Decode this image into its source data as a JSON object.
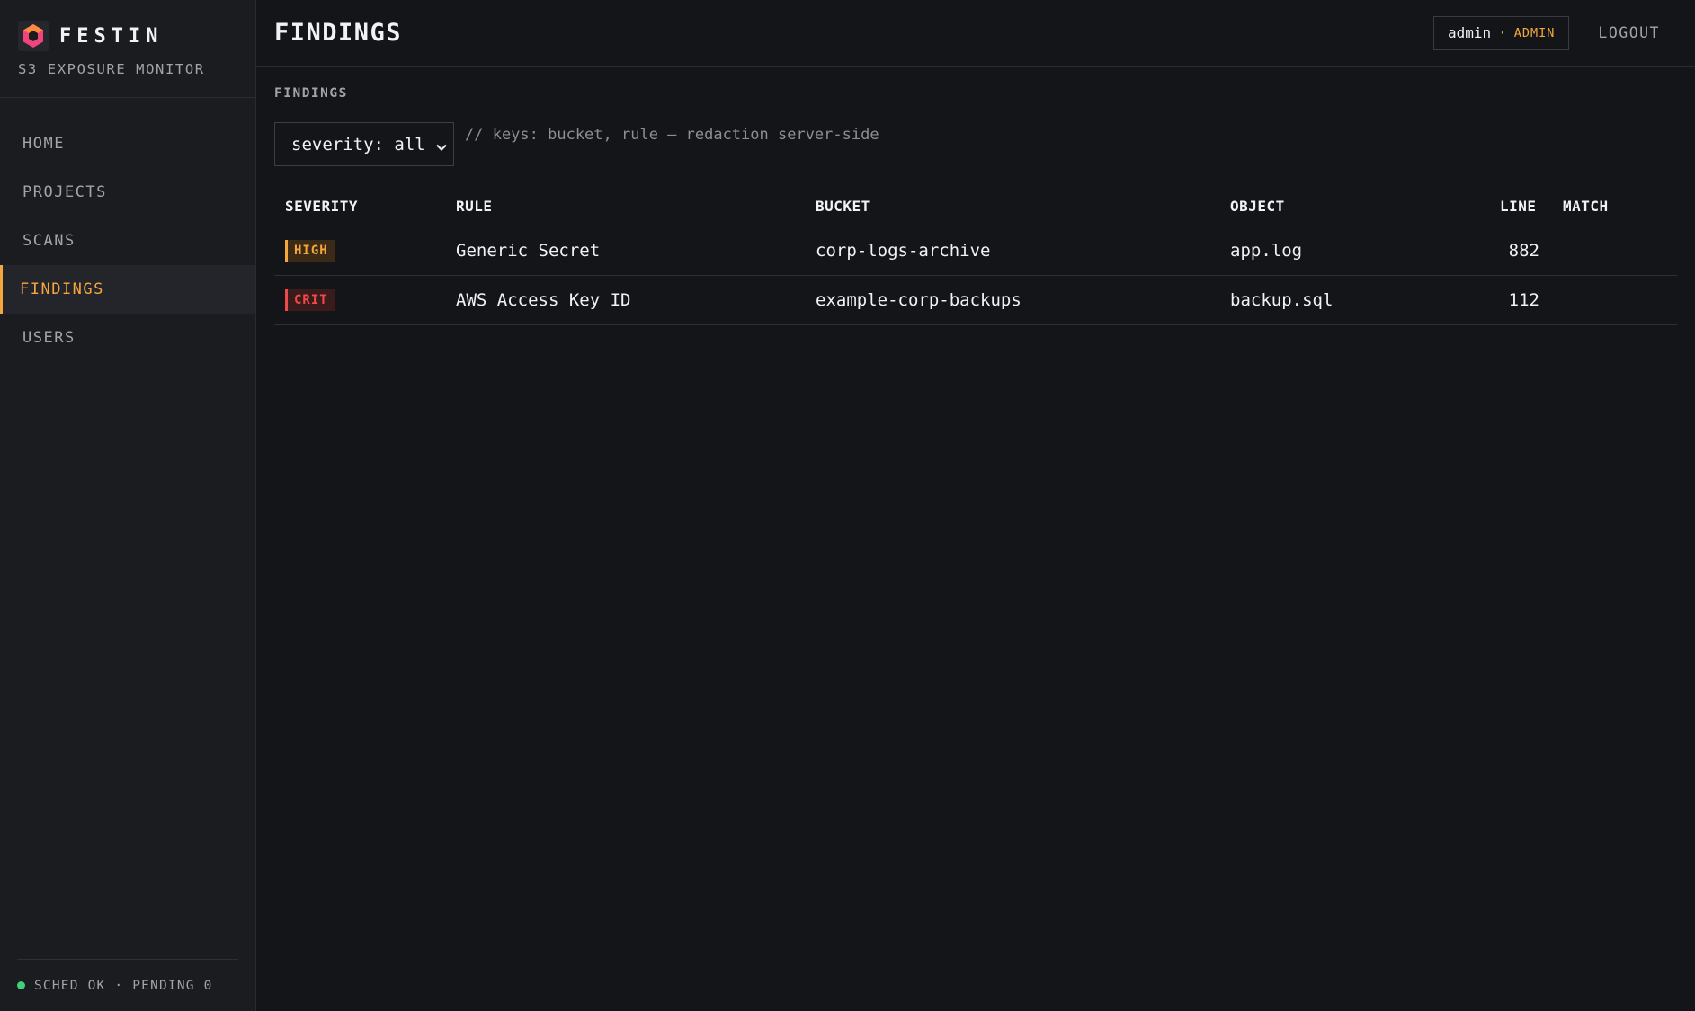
{
  "brand": {
    "name": "FESTIN",
    "subtitle": "S3 EXPOSURE MONITOR"
  },
  "nav": {
    "items": [
      {
        "label": "HOME",
        "active": false
      },
      {
        "label": "PROJECTS",
        "active": false
      },
      {
        "label": "SCANS",
        "active": false
      },
      {
        "label": "FINDINGS",
        "active": true
      },
      {
        "label": "USERS",
        "active": false
      }
    ]
  },
  "footer": {
    "status": "SCHED OK · PENDING 0"
  },
  "header": {
    "title": "FINDINGS",
    "user": {
      "name": "admin",
      "separator": "·",
      "role": "ADMIN"
    },
    "logout_label": "LOGOUT"
  },
  "main": {
    "section_label": "FINDINGS",
    "filter": {
      "selected": "severity: all"
    },
    "hint": "// keys: bucket, rule — redaction server-side",
    "table": {
      "columns": [
        "SEVERITY",
        "RULE",
        "BUCKET",
        "OBJECT",
        "LINE",
        "MATCH"
      ],
      "rows": [
        {
          "severity": "HIGH",
          "rule": "Generic Secret",
          "bucket": "corp-logs-archive",
          "object": "app.log",
          "line": "882",
          "match": ""
        },
        {
          "severity": "CRIT",
          "rule": "AWS Access Key ID",
          "bucket": "example-corp-backups",
          "object": "backup.sql",
          "line": "112",
          "match": ""
        }
      ]
    }
  },
  "colors": {
    "accent": "#f5a63d",
    "critical": "#ef4a4a",
    "ok": "#3fd07a",
    "background": "#141518",
    "sidebar": "#1b1c20"
  },
  "icons": {
    "logo": "festin-hex-logo-icon",
    "select_chevron": "chevron-down-icon",
    "status": "status-dot-icon"
  }
}
